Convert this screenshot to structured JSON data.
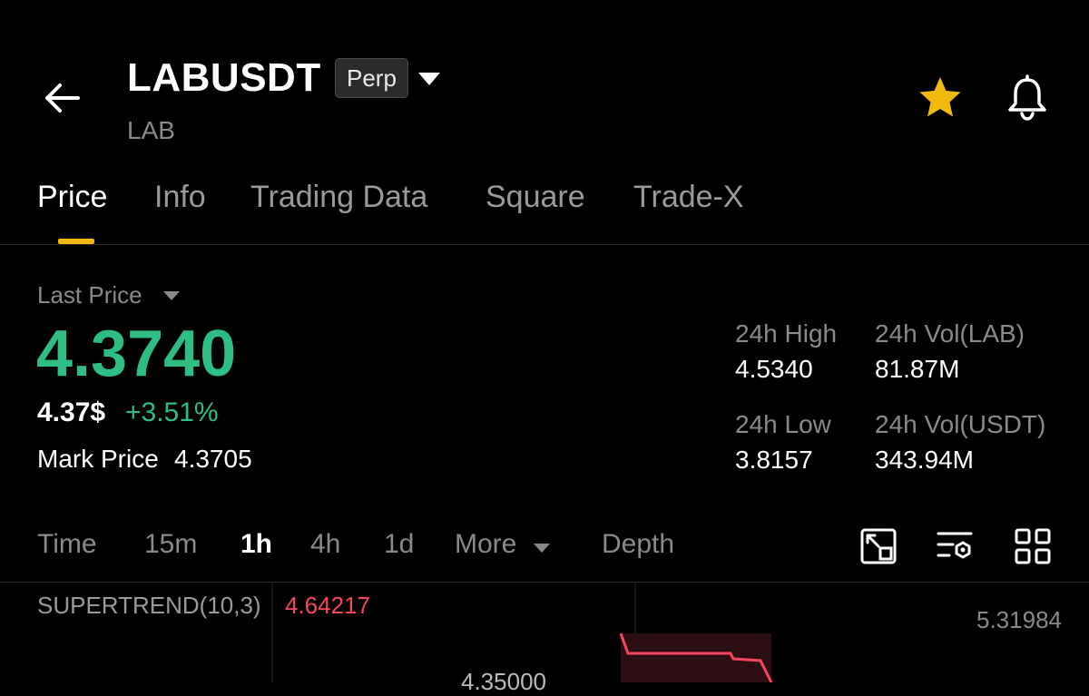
{
  "header": {
    "symbol": "LABUSDT",
    "badge": "Perp",
    "subtitle": "LAB",
    "icons": [
      "back-arrow-icon",
      "caret-down-icon",
      "star-icon",
      "bell-icon"
    ]
  },
  "tabs": [
    {
      "label": "Price",
      "active": true
    },
    {
      "label": "Info",
      "active": false
    },
    {
      "label": "Trading Data",
      "active": false
    },
    {
      "label": "Square",
      "active": false
    },
    {
      "label": "Trade-X",
      "active": false
    }
  ],
  "price": {
    "last_price_label": "Last Price",
    "last_price": "4.3740",
    "usd_price": "4.37$",
    "change_pct": "+3.51%",
    "mark_label": "Mark Price",
    "mark_value": "4.3705"
  },
  "stats": {
    "high_label": "24h High",
    "high_value": "4.5340",
    "low_label": "24h Low",
    "low_value": "3.8157",
    "vol_base_label": "24h Vol(LAB)",
    "vol_base_value": "81.87M",
    "vol_quote_label": "24h Vol(USDT)",
    "vol_quote_value": "343.94M"
  },
  "range_bar": {
    "items": [
      "Time",
      "15m",
      "1h",
      "4h",
      "1d",
      "More",
      "Depth"
    ],
    "active": "1h",
    "tool_icons": [
      "expand-chart-icon",
      "indicator-settings-icon",
      "grid-layout-icon"
    ]
  },
  "chart": {
    "indicator_label": "SUPERTREND(10,3)",
    "indicator_value": "4.64217",
    "axis_top_price": "5.31984",
    "partial_label": "4.35000"
  },
  "colors": {
    "up": "#2EBD85",
    "down": "#F6465D",
    "accent": "#F0B90B",
    "background": "#000000"
  }
}
